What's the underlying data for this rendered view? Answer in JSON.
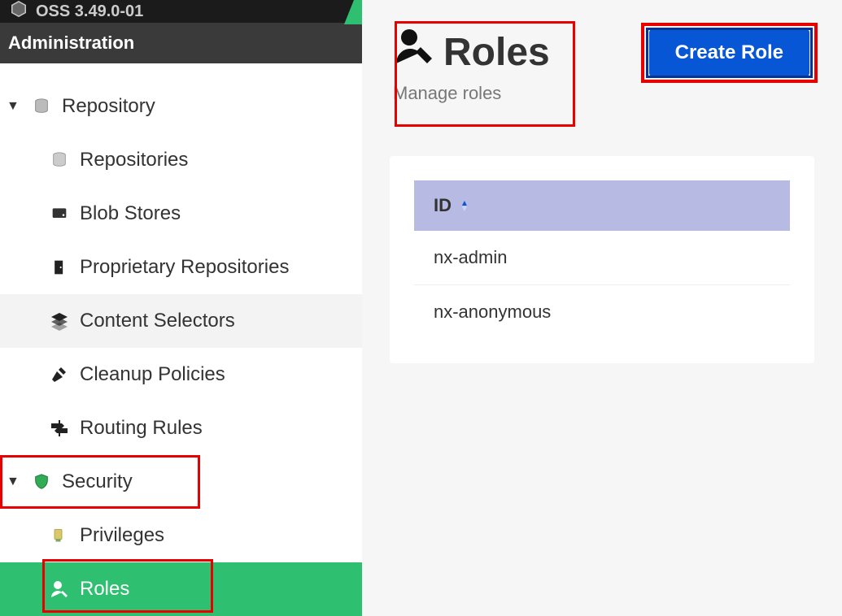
{
  "topbar": {
    "product": "OSS 3.49.0-01"
  },
  "section_header": "Administration",
  "sidebar": {
    "repository": {
      "label": "Repository",
      "items": [
        {
          "label": "Repositories"
        },
        {
          "label": "Blob Stores"
        },
        {
          "label": "Proprietary Repositories"
        },
        {
          "label": "Content Selectors"
        },
        {
          "label": "Cleanup Policies"
        },
        {
          "label": "Routing Rules"
        }
      ]
    },
    "security": {
      "label": "Security",
      "items": [
        {
          "label": "Privileges"
        },
        {
          "label": "Roles"
        }
      ]
    }
  },
  "page": {
    "title": "Roles",
    "subtitle": "Manage roles",
    "create_button": "Create Role"
  },
  "table": {
    "header_id": "ID",
    "rows": [
      {
        "id": "nx-admin"
      },
      {
        "id": "nx-anonymous"
      }
    ]
  }
}
